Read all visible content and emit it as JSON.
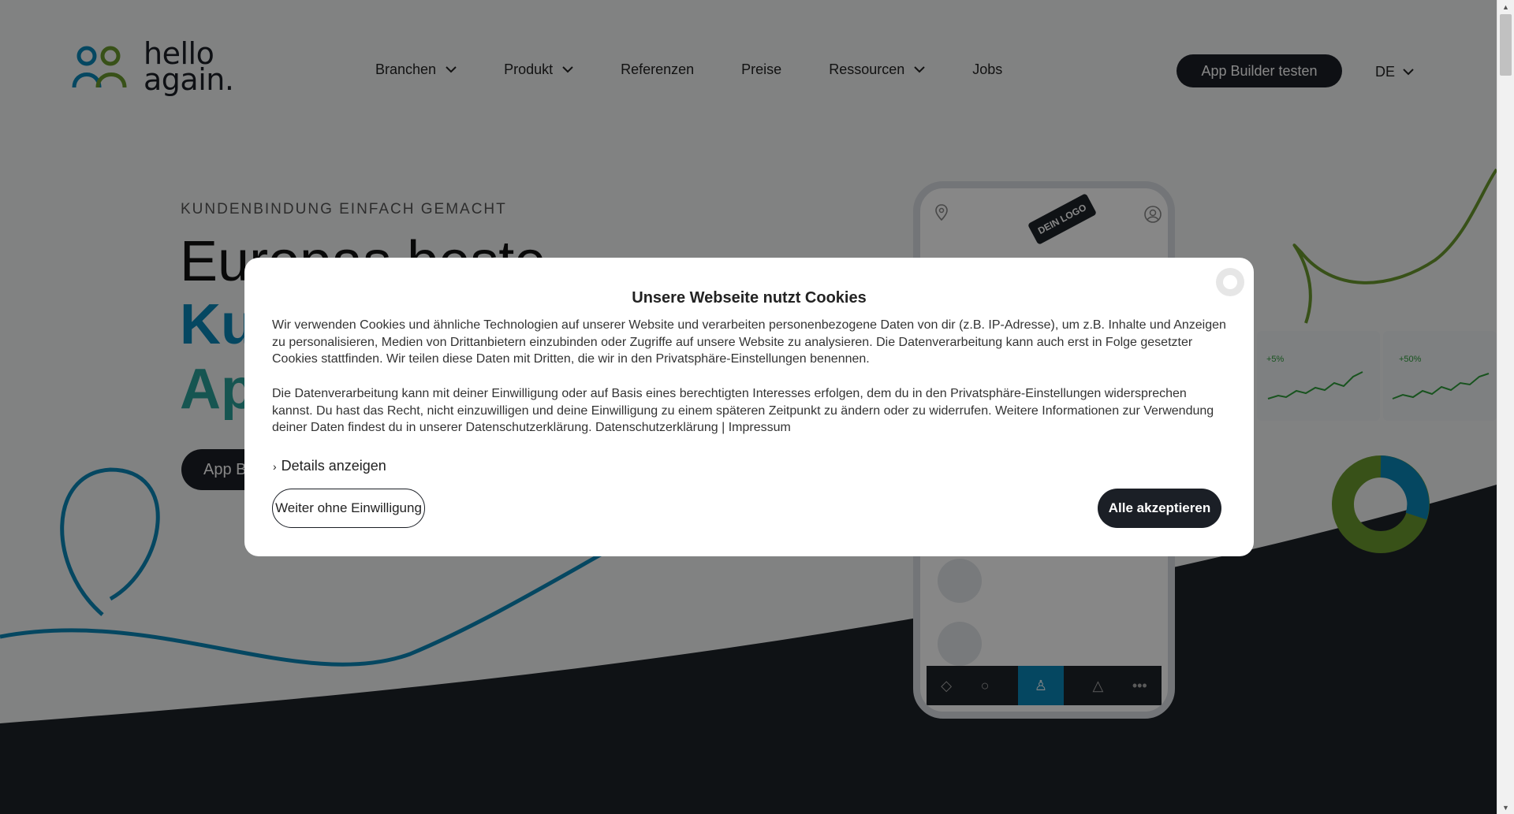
{
  "header": {
    "logo": {
      "line1": "hello",
      "line2": "again."
    },
    "nav": [
      {
        "label": "Branchen",
        "has_dropdown": true
      },
      {
        "label": "Produkt",
        "has_dropdown": true
      },
      {
        "label": "Referenzen",
        "has_dropdown": false
      },
      {
        "label": "Preise",
        "has_dropdown": false
      },
      {
        "label": "Ressourcen",
        "has_dropdown": true
      },
      {
        "label": "Jobs",
        "has_dropdown": false
      }
    ],
    "cta": "App Builder testen",
    "language": "DE"
  },
  "hero": {
    "eyebrow": "KUNDENBINDUNG EINFACH GEMACHT",
    "headline_visible": "Europas beste",
    "accent1_visible": "Ku",
    "accent2_visible": "Ap",
    "button_visible": "App B"
  },
  "phone": {
    "logo_tag": "DEIN LOGO",
    "stat1": "+5%",
    "stat2": "+50%",
    "nav_icons": [
      "diamond-icon",
      "circle-icon",
      "person-icon",
      "triangle-icon",
      "more-icon"
    ]
  },
  "cookie": {
    "title": "Unsere Webseite nutzt Cookies",
    "p1": "Wir verwenden Cookies und ähnliche Technologien auf unserer Website und verarbeiten personenbezogene Daten von dir (z.B. IP-Adresse), um z.B. Inhalte und Anzeigen zu personalisieren, Medien von Drittanbietern einzubinden oder Zugriffe auf unsere Website zu analysieren. Die Datenverarbeitung kann auch erst in Folge gesetzter Cookies stattfinden. Wir teilen diese Daten mit Dritten, die wir in den Privatsphäre-Einstellungen benennen.",
    "p2": "Die Datenverarbeitung kann mit deiner Einwilligung oder auf Basis eines berechtigten Interesses erfolgen, dem du in den Privatsphäre-Einstellungen widersprechen kannst. Du hast das Recht, nicht einzuwilligen und deine Einwilligung zu einem späteren Zeitpunkt zu ändern oder zu widerrufen. Weitere Informationen zur Verwendung deiner Daten findest du in unserer Datenschutzerklärung.",
    "link_privacy": "Datenschutzerklärung",
    "separator": "|",
    "link_imprint": "Impressum",
    "details": "Details anzeigen",
    "deny": "Weiter ohne Einwilligung",
    "accept": "Alle akzeptieren"
  },
  "colors": {
    "brand_dark": "#1b1f26",
    "brand_blue": "#0b87b8",
    "brand_green": "#6a9a2e"
  }
}
